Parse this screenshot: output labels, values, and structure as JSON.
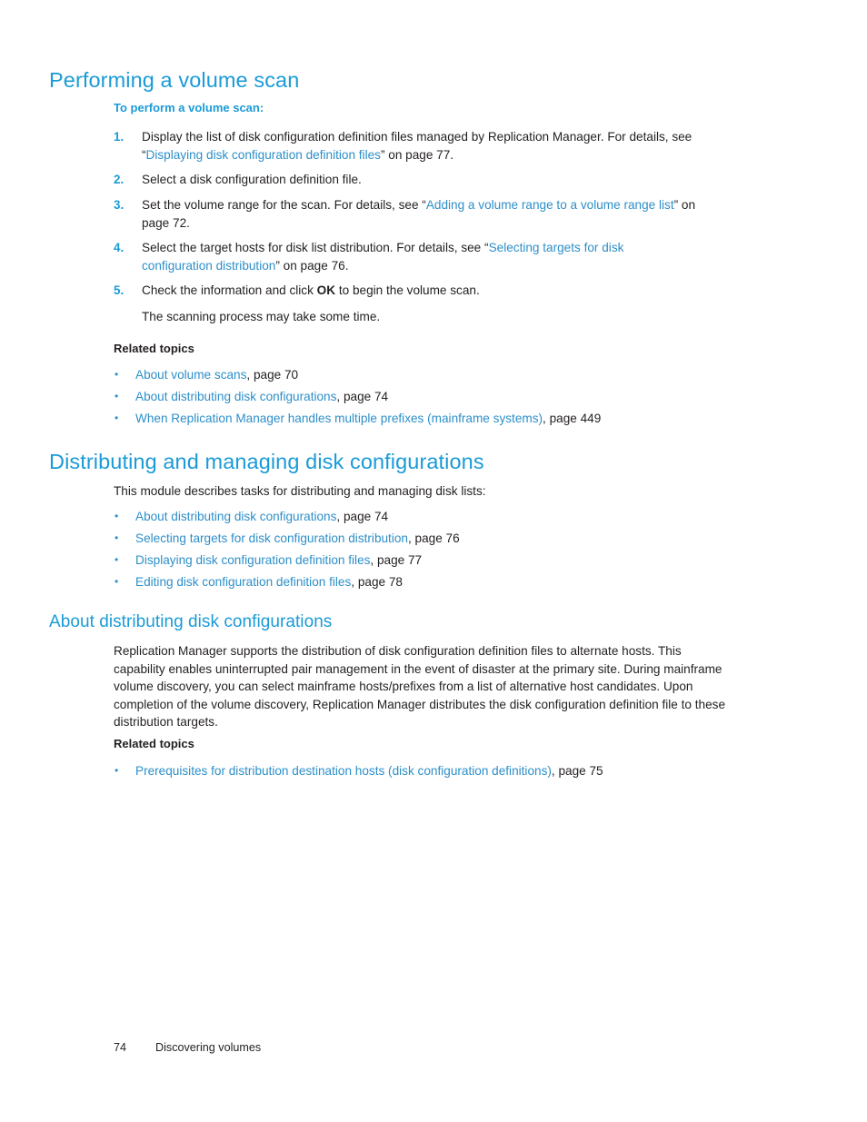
{
  "colors": {
    "heading_blue": "#1a9bd7",
    "link_blue": "#2d8fc9",
    "body_text": "#231f20",
    "page_background": "#ffffff"
  },
  "section1": {
    "title": "Performing a volume scan",
    "subhead": "To perform a volume scan:",
    "steps": [
      {
        "number": "1.",
        "pre": "Display the list of disk configuration definition files managed by Replication Manager. For details, see “",
        "link": "Displaying disk configuration definition files",
        "post": "” on page 77."
      },
      {
        "number": "2.",
        "pre": "Select a disk configuration definition file.",
        "link": "",
        "post": ""
      },
      {
        "number": "3.",
        "pre": "Set the volume range for the scan. For details, see “",
        "link": "Adding a volume range to a volume range list",
        "post": "” on page 72."
      },
      {
        "number": "4.",
        "pre": "Select the target hosts for disk list distribution. For details, see “",
        "link": "Selecting targets for disk configuration distribution",
        "post": "” on page 76."
      },
      {
        "number": "5.",
        "pre": "Check the information and click ",
        "emphasis": "OK",
        "post": " to begin the volume scan."
      }
    ],
    "step5_note": "The scanning process may take some time.",
    "related_topics_heading": "Related topics",
    "related_topics": [
      {
        "bullet": "•",
        "link": "About volume scans",
        "suffix": ", page 70"
      },
      {
        "bullet": "•",
        "link": "About distributing disk configurations",
        "suffix": ", page 74"
      },
      {
        "bullet": "•",
        "link": "When Replication Manager handles multiple prefixes (mainframe systems)",
        "suffix": ", page 449"
      }
    ]
  },
  "section2": {
    "title": "Distributing and managing disk configurations",
    "intro": "This module describes tasks for distributing and managing disk lists:",
    "links": [
      {
        "bullet": "•",
        "link": "About distributing disk configurations",
        "suffix": ", page 74"
      },
      {
        "bullet": "•",
        "link": "Selecting targets for disk configuration distribution",
        "suffix": ", page 76"
      },
      {
        "bullet": "•",
        "link": "Displaying disk configuration definition files",
        "suffix": ", page 77"
      },
      {
        "bullet": "•",
        "link": "Editing disk configuration definition files",
        "suffix": ", page 78"
      }
    ]
  },
  "section3": {
    "title": "About distributing disk configurations",
    "paragraph": "Replication Manager supports the distribution of disk configuration definition files to alternate hosts. This capability enables uninterrupted pair management in the event of disaster at the primary site. During mainframe volume discovery, you can select mainframe hosts/prefixes from a list of alternative host candidates. Upon completion of the volume discovery, Replication Manager distributes the disk configuration definition file to these distribution targets.",
    "related_topics_heading": "Related topics",
    "related_topics": [
      {
        "bullet": "•",
        "link": "Prerequisites for distribution destination hosts (disk configuration definitions)",
        "suffix": ", page 75"
      }
    ]
  },
  "footer": {
    "page_number": "74",
    "chapter": "Discovering volumes"
  }
}
